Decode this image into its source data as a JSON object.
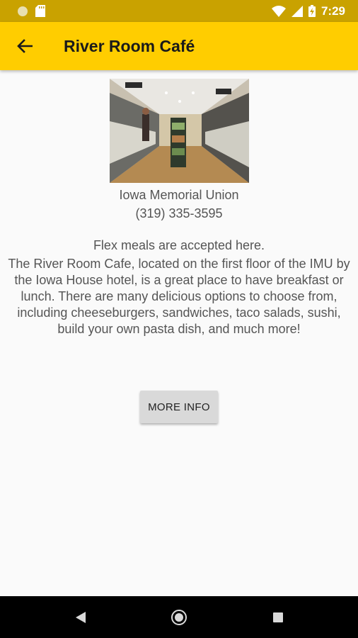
{
  "status_bar": {
    "time": "7:29",
    "icons": [
      "circle-notification-icon",
      "sd-card-icon",
      "wifi-icon",
      "signal-icon",
      "battery-charging-icon"
    ]
  },
  "app_bar": {
    "title": "River Room Café",
    "back_icon": "arrow-back-icon"
  },
  "venue": {
    "image_icon": "cafeteria-photo",
    "location": "Iowa Memorial Union",
    "phone": "(319) 335-3595",
    "flex_note": "Flex meals are accepted here.",
    "description": "The River Room Cafe, located on the first floor of the IMU by the Iowa House hotel, is a great place to have breakfast or lunch. There are many delicious options to choose from, including cheeseburgers, sandwiches, taco salads, sushi, build your own pasta dish, and much more!",
    "more_info_label": "MORE INFO"
  },
  "nav_bar": {
    "buttons": [
      "back-triangle-icon",
      "home-circle-icon",
      "recents-square-icon"
    ]
  },
  "colors": {
    "status_bar": "#c9a200",
    "app_bar": "#ffcd00",
    "background": "#fafafa",
    "button": "#d9d9d9",
    "text": "#555555"
  }
}
